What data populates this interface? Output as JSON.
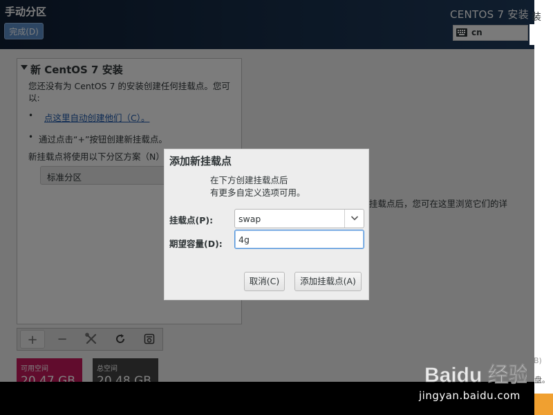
{
  "header": {
    "page_title": "手动分区",
    "done_button": "完成(D)",
    "installer_title": "CENTOS 7 安装",
    "keyboard_layout": "cn"
  },
  "left_panel": {
    "section_title": "新 CentOS 7 安装",
    "info_text": "您还没有为 CentOS 7 的安装创建任何挂载点。您可以:",
    "bullet": "•",
    "auto_create_link": "点这里自动创建他们（C）。",
    "plus_instruction": "通过点击“+”按钮创建新挂载点。",
    "scheme_label": "新挂载点将使用以下分区方案（N）:",
    "scheme_value": "标准分区"
  },
  "toolbar": {
    "add": "+",
    "remove": "−",
    "configure_icon": "wrench-screwdriver-icon",
    "refresh_icon": "refresh-icon",
    "reset_icon": "reset-icon"
  },
  "space": {
    "available_label": "可用空间",
    "available_value": "20.47 GB",
    "total_label": "总空间",
    "total_value": "20.48 GB"
  },
  "right_hint": "挂载点后，您可在这里浏览它们的详",
  "dialog": {
    "title": "添加新挂载点",
    "description_line1": "在下方创建挂载点后",
    "description_line2": "有更多自定义选项可用。",
    "mount_point_label": "挂载点(P):",
    "mount_point_value": "swap",
    "desired_capacity_label": "期望容量(D):",
    "desired_capacity_value": "4g",
    "cancel_button": "取消(C)",
    "add_button": "添加挂载点(A)"
  },
  "right_strip": {
    "partial_char": "装",
    "partial_b": "B)",
    "partial_disk": "盘。"
  },
  "watermark": {
    "brand": "Baidu 经验",
    "url": "jingyan.baidu.com"
  },
  "colors": {
    "header_bg": "#162b45",
    "done_button_bg": "#5b8dc7",
    "available_tile": "#c2185b",
    "total_tile": "#424242",
    "link": "#1d57a8",
    "focus_border": "#4a90d9"
  }
}
